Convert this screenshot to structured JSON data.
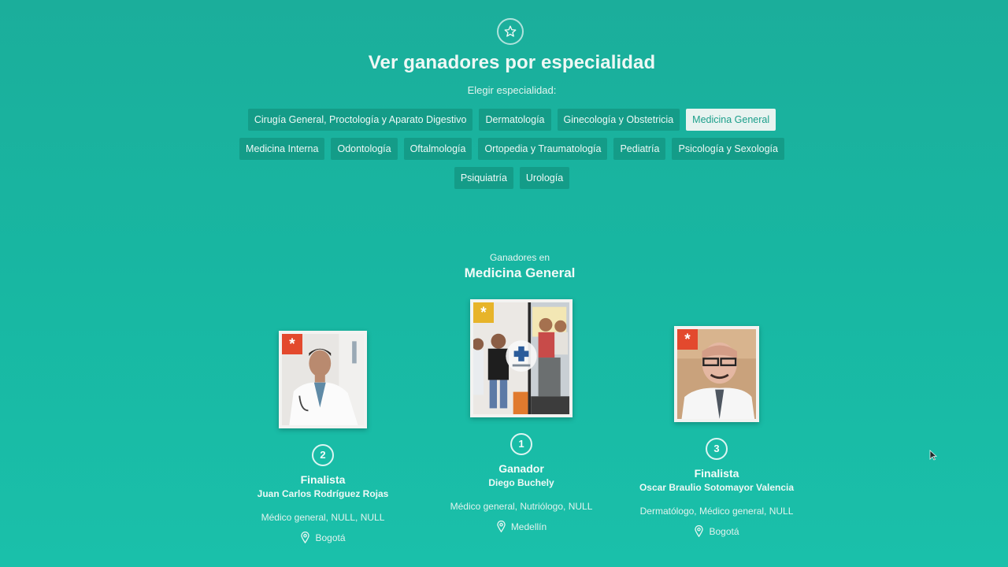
{
  "header": {
    "icon": "star-icon",
    "title": "Ver ganadores por especialidad",
    "choose_label": "Elegir especialidad:"
  },
  "specialties": [
    {
      "label": "Cirugía General, Proctología y Aparato Digestivo",
      "active": false
    },
    {
      "label": "Dermatología",
      "active": false
    },
    {
      "label": "Ginecología y Obstetricia",
      "active": false
    },
    {
      "label": "Medicina General",
      "active": true
    },
    {
      "label": "Medicina Interna",
      "active": false
    },
    {
      "label": "Odontología",
      "active": false
    },
    {
      "label": "Oftalmología",
      "active": false
    },
    {
      "label": "Ortopedia y Traumatología",
      "active": false
    },
    {
      "label": "Pediatría",
      "active": false
    },
    {
      "label": "Psicología y Sexología",
      "active": false
    },
    {
      "label": "Psiquiatría",
      "active": false
    },
    {
      "label": "Urología",
      "active": false
    }
  ],
  "winners": {
    "subtitle": "Ganadores en",
    "specialty": "Medicina General",
    "cards": [
      {
        "rank": "2",
        "status": "Finalista",
        "name": "Juan Carlos Rodríguez Rojas",
        "specialties": "Médico general, NULL, NULL",
        "city": "Bogotá",
        "badge_color": "#e3492d"
      },
      {
        "rank": "1",
        "status": "Ganador",
        "name": "Diego Buchely",
        "specialties": "Médico general, Nutriólogo, NULL",
        "city": "Medellín",
        "badge_color": "#e7b42a"
      },
      {
        "rank": "3",
        "status": "Finalista",
        "name": "Oscar Braulio Sotomayor Valencia",
        "specialties": "Dermatólogo, Médico general, NULL",
        "city": "Bogotá",
        "badge_color": "#e3492d"
      }
    ]
  },
  "colors": {
    "background": "#1bb5a1",
    "chip": "#149c88",
    "chip_active": "#e8f3f0"
  }
}
